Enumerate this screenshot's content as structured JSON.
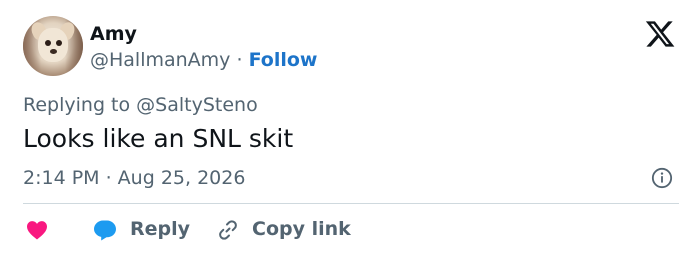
{
  "author": {
    "name": "Amy",
    "handle": "@HallmanAmy",
    "separator": "·",
    "follow_label": "Follow",
    "avatar": "dog-avatar"
  },
  "brand": {
    "logo": "x-logo-icon"
  },
  "tweet": {
    "replying_prefix": "Replying to",
    "replying_to": "@SaltySteno",
    "text": "Looks like an SNL skit",
    "timestamp": "2:14 PM · Aug 25, 2026"
  },
  "actions": {
    "like_icon": "heart-icon",
    "reply_label": "Reply",
    "copy_link_label": "Copy link"
  },
  "colors": {
    "text": "#0f1419",
    "secondary": "#536471",
    "accent": "#1d74c9",
    "like": "#f91880",
    "reply": "#1d9bf0",
    "divider": "#cfd9de"
  }
}
